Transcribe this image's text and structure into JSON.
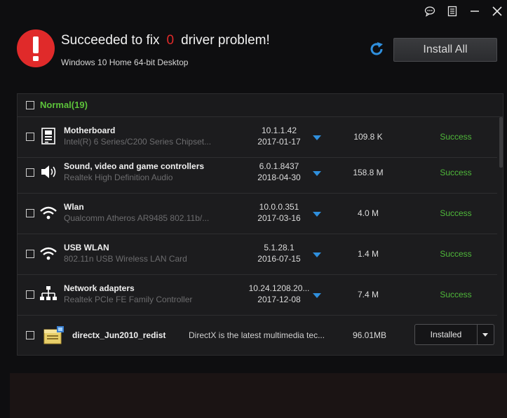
{
  "window": {
    "feedback_icon": "chat-bubble-icon",
    "menu_icon": "menu-icon",
    "minimize_icon": "minimize-icon",
    "close_icon": "close-icon"
  },
  "header": {
    "headline_prefix": "Succeeded to fix",
    "problem_count": "0",
    "headline_suffix": "driver problem!",
    "os_info": "Windows 10 Home 64-bit Desktop",
    "install_all_label": "Install All",
    "status_color": "#e02a2a",
    "accent_blue": "#2f8fdd"
  },
  "group": {
    "label": "Normal(19)",
    "color": "#5cc33a"
  },
  "drivers": [
    {
      "name": "Motherboard",
      "description": "Intel(R) 6 Series/C200 Series Chipset...",
      "version": "10.1.1.42",
      "date": "2017-01-17",
      "size": "109.8 K",
      "status": "Success",
      "icon": "motherboard-icon"
    },
    {
      "name": "Sound, video and game controllers",
      "description": "Realtek High Definition Audio",
      "version": "6.0.1.8437",
      "date": "2018-04-30",
      "size": "158.8 M",
      "status": "Success",
      "icon": "speaker-icon"
    },
    {
      "name": "Wlan",
      "description": "Qualcomm Atheros AR9485 802.11b/...",
      "version": "10.0.0.351",
      "date": "2017-03-16",
      "size": "4.0 M",
      "status": "Success",
      "icon": "wifi-icon"
    },
    {
      "name": "USB WLAN",
      "description": "802.11n USB Wireless LAN Card",
      "version": "5.1.28.1",
      "date": "2016-07-15",
      "size": "1.4 M",
      "status": "Success",
      "icon": "wifi-icon"
    },
    {
      "name": "Network adapters",
      "description": "Realtek PCIe FE Family Controller",
      "version": "10.24.1208.20...",
      "date": "2017-12-08",
      "size": "7.4 M",
      "status": "Success",
      "icon": "network-icon"
    }
  ],
  "extra": {
    "name": "directx_Jun2010_redist",
    "description": "DirectX is the latest multimedia tec...",
    "size": "96.01MB",
    "button_label": "Installed",
    "icon": "package-icon"
  }
}
